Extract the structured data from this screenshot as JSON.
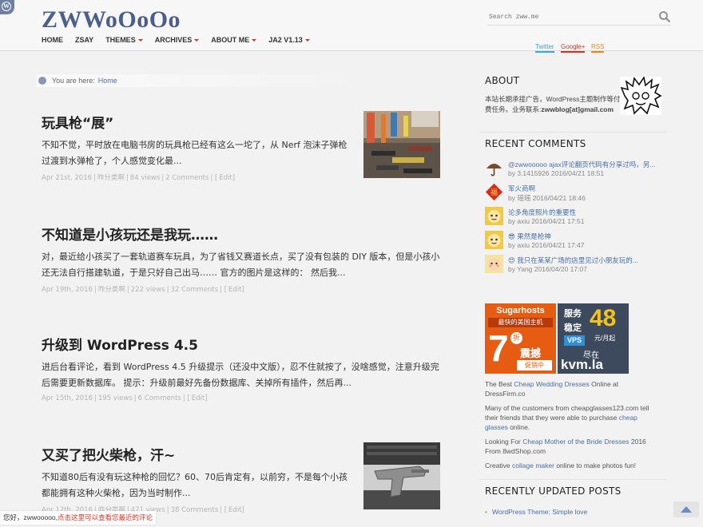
{
  "site": {
    "logo": "ZWWoOoOo",
    "search_placeholder": "Search zww.me"
  },
  "nav": {
    "items": [
      {
        "label": "HOME",
        "has_dropdown": false
      },
      {
        "label": "ZSAY",
        "has_dropdown": false
      },
      {
        "label": "THEMES",
        "has_dropdown": true
      },
      {
        "label": "ARCHIVES",
        "has_dropdown": true
      },
      {
        "label": "ABOUT ME",
        "has_dropdown": true
      },
      {
        "label": "JA2 V1.13",
        "has_dropdown": true
      }
    ]
  },
  "social": {
    "twitter": "Twitter",
    "google": "Google+",
    "rss": "RSS"
  },
  "breadcrumb": {
    "prefix": "You are here:",
    "home": "Home"
  },
  "posts": [
    {
      "title": "玩具枪“展”",
      "excerpt": "不知不觉，平时放在电脑书房的玩具枪已经有这么一坨了，从 Nerf 泡沫子弹枪过渡到水弹枪了，个人感觉变化最...",
      "date": "Apr 21st, 2016",
      "category": "咋分类啊",
      "views": "84 views",
      "comments": "2 Comments",
      "edit": "Edit"
    },
    {
      "title": "不知道是小孩玩还是我玩……",
      "excerpt": "对，最近给小孩买了一套轨道赛车玩具，为了省钱又赛道长点，买了没有包装的 DIY 版本，但是小孩小还无法自行搭建轨道，于是只好自己出马…… 官方的图片是这样的： 然后我...",
      "date": "Apr 19th, 2016",
      "category": "咋分类啊",
      "views": "222 views",
      "comments": "32 Comments",
      "edit": "Edit"
    },
    {
      "title": "升级到 WordPress 4.5",
      "excerpt": "进后台看评论，看到 WordPress 4.5 升级提示（还没中文版），忍不住就按了，没啥感觉，注意升级完后需要更新数据库。 提示：升级前最好先备份数据库、关掉所有插件，然后再...",
      "date": "Apr 15th, 2016",
      "category": "",
      "views": "195 views",
      "comments": "6 Comments",
      "edit": "Edit"
    },
    {
      "title": "又买了把火柴枪，汗~",
      "excerpt": "不知道80后有没有玩这种枪的回忆？60、70后肯定有，以前穷，不是每个小孩都能拥有这种火柴枪，因为当时制作...",
      "date": "Apr 12th, 2016",
      "category": "咋分类啊",
      "views": "471 views",
      "comments": "38 Comments",
      "edit": "Edit"
    }
  ],
  "sidebar": {
    "about_heading": "ABOUT",
    "about_text_1": "本站长期承接广告，WordPress主题制作等付费任务。业务联系:",
    "about_email": "zwwblog[at]gmail.com",
    "recent_heading": "RECENT COMMENTS",
    "comments": [
      {
        "text": "@zwwooooo ajax评论翻页代码有分享过吗，另...",
        "meta": "by 3.1415926 2016/04/21 18:51",
        "avatar": "umbrella"
      },
      {
        "text": "军火商啊",
        "meta": "by 瑶瑶 2016/04/21 18:46",
        "avatar": "fu"
      },
      {
        "text": "论多角度照片的重要性",
        "meta": "by axiu 2016/04/21 17:51",
        "avatar": "face"
      },
      {
        "text": "😎 果然是枪神",
        "meta": "by axiu 2016/04/21 17:47",
        "avatar": "face"
      },
      {
        "text": "😍 我只在某某广场的店里见过小朋友玩的...",
        "meta": "by Yang 2016/04/20 17:07",
        "avatar": "baby"
      }
    ],
    "ad1": {
      "brand": "Sugarhosts",
      "line1": "最快的美国主机",
      "big": "7",
      "unit": "折",
      "line2": "震撼",
      "line3": "促销中"
    },
    "ad2": {
      "line1": "服务",
      "line2": "稳定",
      "vps": "VPS",
      "big": "48",
      "per": "元/月起",
      "line3": "尽在",
      "domain": "kvm.la"
    },
    "ad_text_1_pre": "The Best",
    "ad_text_1_link": "Cheap Wedding Dresses",
    "ad_text_1_post": "Online at DressFirm.co",
    "ad_text_2_pre": "Many of the customers from cheapglasses123.com tell their friends that they were able to purchase",
    "ad_text_2_link": "cheap glasses",
    "ad_text_2_post": "online.",
    "ad_text_3_pre": "Looking For",
    "ad_text_3_link": "Cheap Mother of the Bride Dresses",
    "ad_text_3_post": "2016 From 8wdShop.com",
    "ad_text_4_pre": "Creative",
    "ad_text_4_link": "collage maker",
    "ad_text_4_post": "online to make photos fun!",
    "updated_heading": "RECENTLY UPDATED POSTS",
    "updated_item": "WordPress Theme: Simple love"
  },
  "toast": {
    "greeting": "您好，zwwooooo,",
    "link": "点击这里可以查看您最近的评论"
  },
  "colors": {
    "accent": "#4a6fa5",
    "logo": "#4b5f8e",
    "caret": "#c0392b"
  }
}
